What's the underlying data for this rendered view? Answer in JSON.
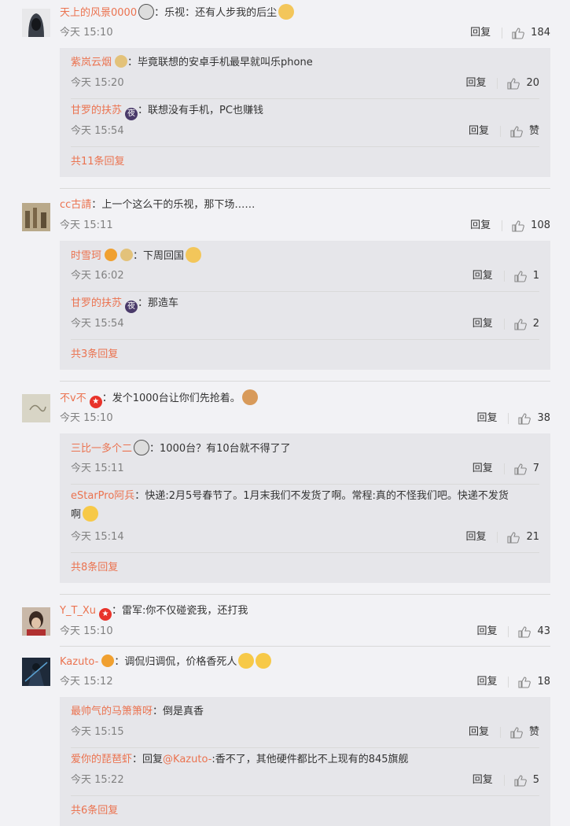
{
  "colors": {
    "username": "#eb7350",
    "meta": "#808080",
    "sub_bg": "#e6e6ea",
    "page_bg": "#f2f2f5"
  },
  "labels": {
    "reply": "回复",
    "colon": "："
  },
  "comments": [
    {
      "user": "天上的风景0000",
      "text": "乐视：还有人步我的后尘",
      "time": "今天 15:10",
      "likes": "184",
      "replies": [
        {
          "user": "紫岚云烟",
          "text": "毕竟联想的安卓手机最早就叫乐phone",
          "time": "今天 15:20",
          "likes": "20"
        },
        {
          "user": "甘罗的扶苏",
          "text": "联想没有手机，PC也赚钱",
          "time": "今天 15:54",
          "likes": "赞"
        }
      ],
      "more": "共11条回复"
    },
    {
      "user": "cc古請",
      "text": "上一个这么干的乐视，那下场……",
      "time": "今天 15:11",
      "likes": "108",
      "replies": [
        {
          "user": "时雪珂",
          "text": "下周回国",
          "time": "今天 16:02",
          "likes": "1"
        },
        {
          "user": "甘罗的扶苏",
          "text": "那造车",
          "time": "今天 15:54",
          "likes": "2"
        }
      ],
      "more": "共3条回复"
    },
    {
      "user": "不v不",
      "text": "发个1000台让你们先抢着。",
      "time": "今天 15:10",
      "likes": "38",
      "replies": [
        {
          "user": "三比一多个二",
          "text": "1000台？有10台就不得了了",
          "time": "今天 15:11",
          "likes": "7"
        },
        {
          "user": "eStarPro阿兵",
          "text": "快递:2月5号春节了。1月末我们不发货了啊。常程:真的不怪我们吧。快递不发货",
          "text2": "啊",
          "time": "今天 15:14",
          "likes": "21"
        }
      ],
      "more": "共8条回复"
    },
    {
      "user": "Y_T_Xu",
      "text": "雷军:你不仅碰瓷我，还打我",
      "time": "今天 15:10",
      "likes": "43"
    },
    {
      "user": "Kazuto-",
      "text": "调侃归调侃，价格香死人",
      "time": "今天 15:12",
      "likes": "18",
      "replies": [
        {
          "user": "最帅气的马箫箫呀",
          "text": "倒是真香",
          "time": "今天 15:15",
          "likes": "赞"
        },
        {
          "user": "爱你的琵琶虾",
          "text_pre": "回复",
          "at": "@Kazuto-",
          "text": ":香不了，其他硬件都比不上现有的845旗舰",
          "time": "今天 15:22",
          "likes": "5"
        }
      ],
      "more": "共6条回复"
    }
  ]
}
